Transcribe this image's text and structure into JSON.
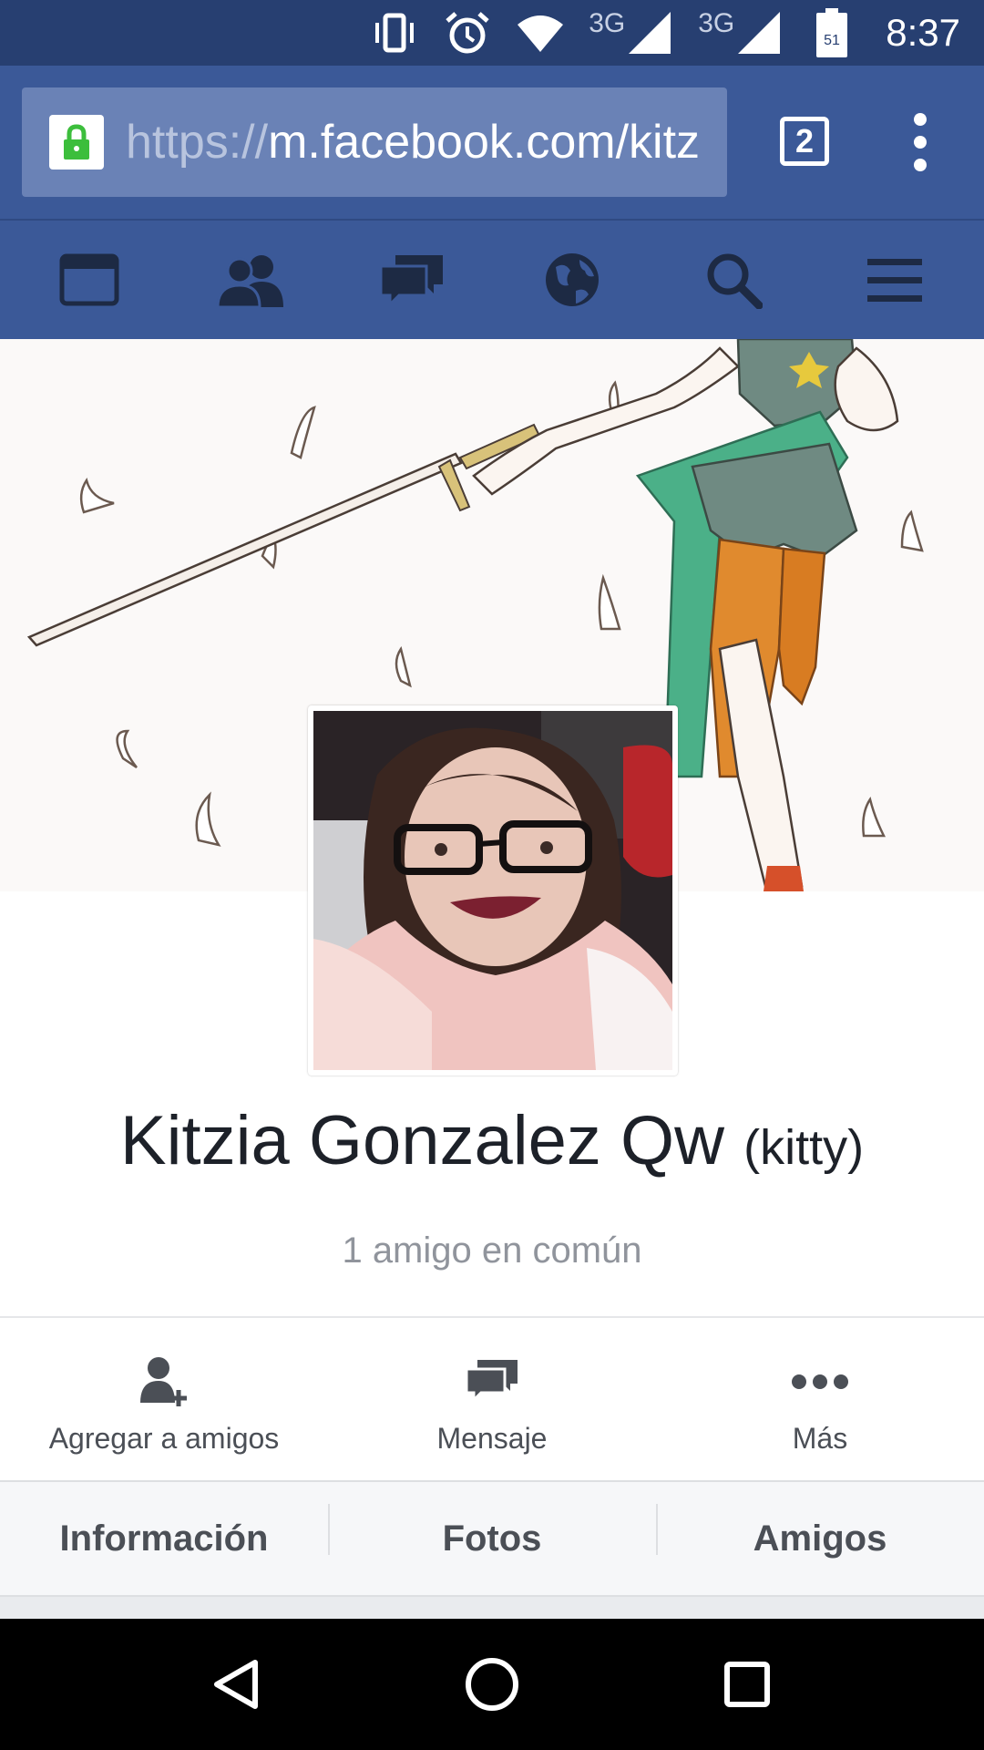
{
  "status_bar": {
    "network_1": "3G",
    "network_2": "3G",
    "battery_level": "51",
    "time": "8:37"
  },
  "browser": {
    "url_scheme": "https://",
    "url_rest": "m.facebook.com/kitz",
    "tab_count": "2"
  },
  "fb_nav": {
    "items": [
      "news-feed",
      "friend-requests",
      "messages",
      "notifications",
      "search",
      "more"
    ]
  },
  "profile": {
    "name": "Kitzia Gonzalez Qw",
    "alternate_name": "(kitty)",
    "mutual_friends": "1 amigo en común"
  },
  "actions": {
    "add_friend": "Agregar a amigos",
    "message": "Mensaje",
    "more": "Más"
  },
  "tabs": {
    "info": "Información",
    "photos": "Fotos",
    "friends": "Amigos"
  },
  "colors": {
    "facebook_blue": "#3b5998",
    "status_bar": "#273f71",
    "lock_green": "#3cbe3c"
  }
}
